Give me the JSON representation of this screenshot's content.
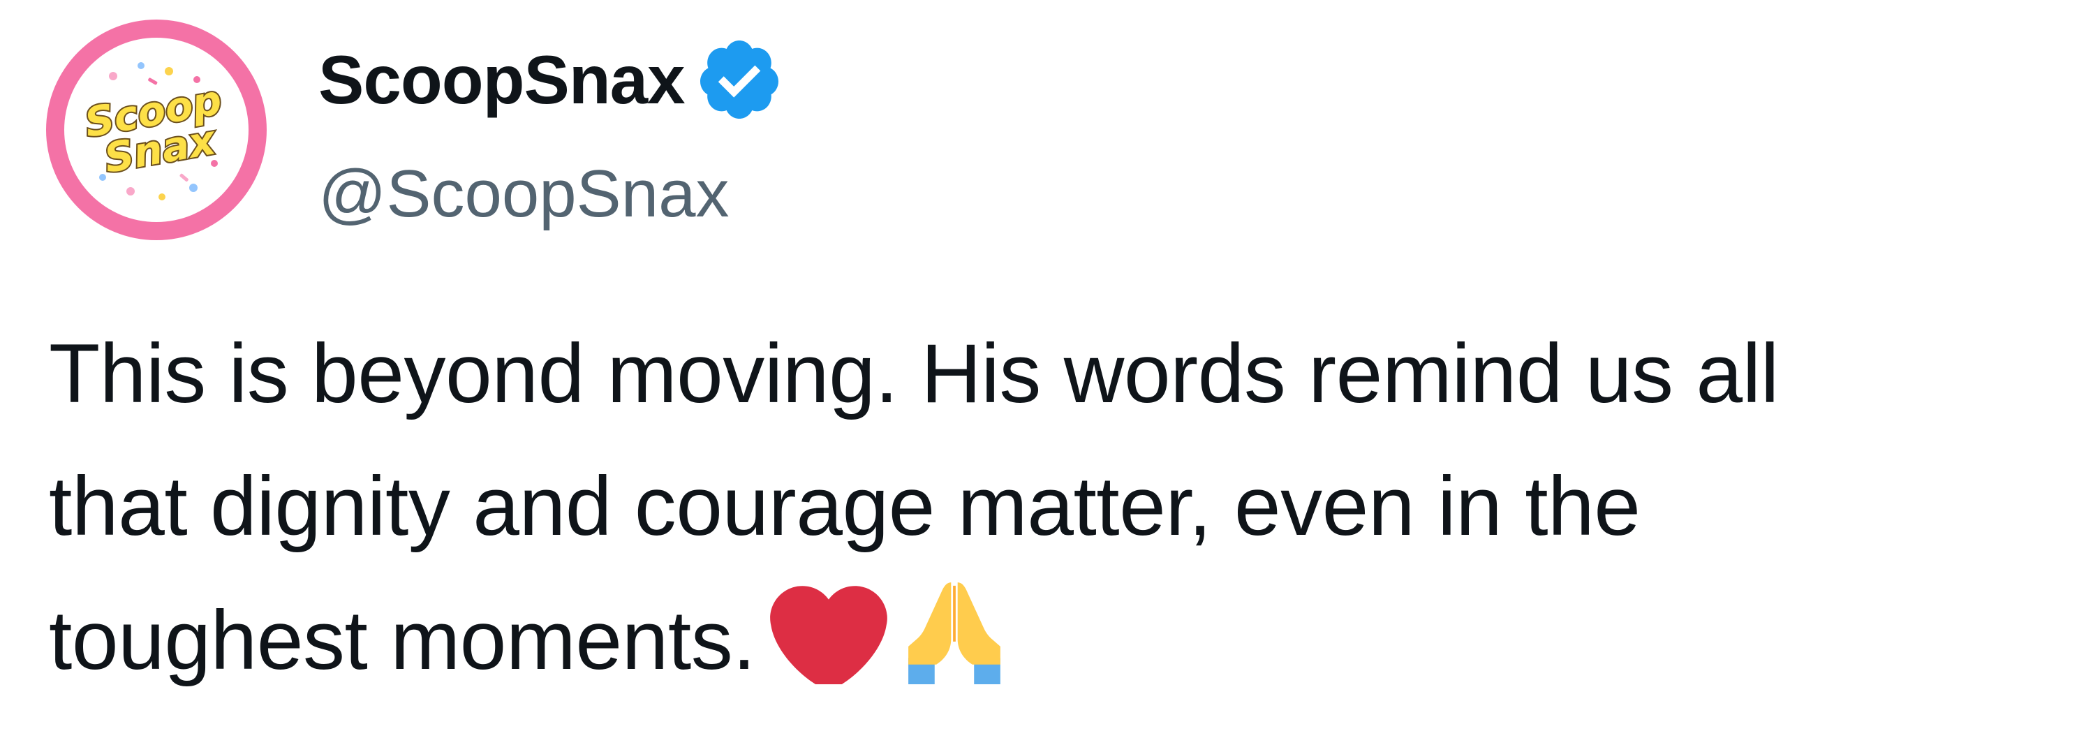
{
  "tweet": {
    "author": {
      "display_name": "ScoopSnax",
      "handle": "@ScoopSnax",
      "verified": true,
      "avatar_logo_line1": "Scoop",
      "avatar_logo_line2": "Snax",
      "avatar_ring_color": "#f472a6"
    },
    "text_line1": "This is beyond moving. His words remind us all",
    "text_line2": "that dignity and courage matter, even in the",
    "text_line3": "toughest moments.",
    "emojis": [
      "red-heart-icon",
      "folded-hands-icon"
    ]
  },
  "colors": {
    "text": "#0f1419",
    "handle": "#536471",
    "verified_badge": "#1d9bf0",
    "heart": "#dd2e44"
  }
}
